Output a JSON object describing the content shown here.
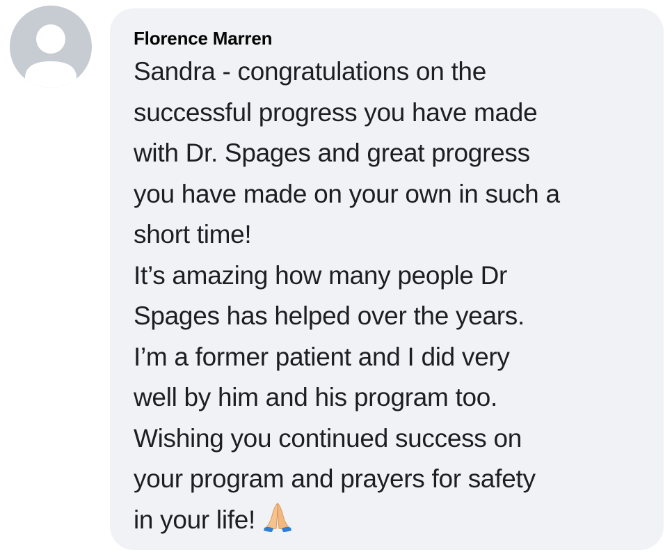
{
  "comment": {
    "author": "Florence Marren",
    "lines": [
      "Sandra - congratulations on the",
      "successful progress you have made",
      "with Dr. Spages and great progress",
      "you have made on your own in such a",
      "short time!",
      "It’s amazing how many people Dr",
      "Spages has helped over the years.",
      "I’m a former patient and I did very",
      "well by him and his program too.",
      "Wishing you continued success on",
      "your program and prayers for safety",
      "in your life!"
    ],
    "emoji": "folded-hands-icon"
  },
  "colors": {
    "bubble_background": "#f0f2f5",
    "avatar_background": "#c7cbd2",
    "avatar_silhouette": "#ffffff",
    "text": "#1c1e21"
  }
}
